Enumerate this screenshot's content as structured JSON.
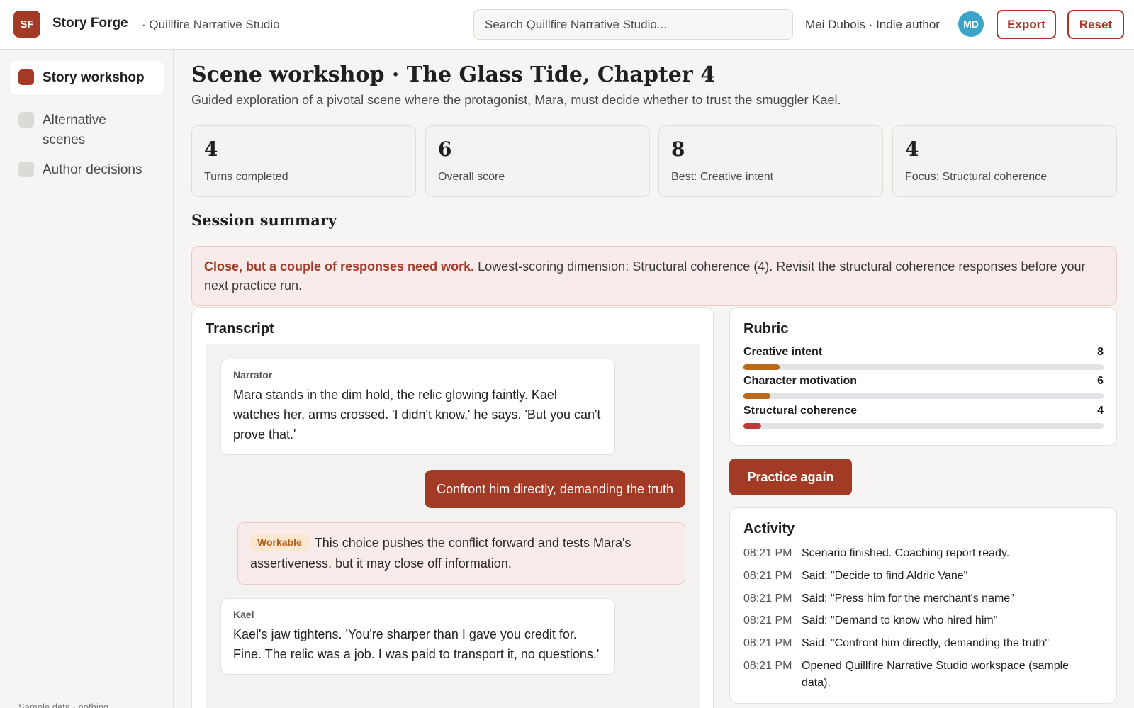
{
  "app": {
    "logo_initials": "SF",
    "name": "Story Forge",
    "org": "· Quillfire Narrative Studio"
  },
  "search": {
    "placeholder": "Search Quillfire Narrative Studio..."
  },
  "user": {
    "label": "Mei Dubois · Indie author",
    "initials": "MD"
  },
  "actions": {
    "export": "Export",
    "reset": "Reset"
  },
  "sidebar": {
    "items": [
      {
        "label": "Story workshop",
        "active": true
      },
      {
        "label": "Alternative scenes",
        "active": false
      },
      {
        "label": "Author decisions",
        "active": false
      }
    ],
    "footer": "Sample data · nothing"
  },
  "page": {
    "title": "Scene workshop · The Glass Tide, Chapter 4",
    "subtitle": "Guided exploration of a pivotal scene where the protagonist, Mara, must decide whether to trust the smuggler Kael."
  },
  "stats": [
    {
      "value": "4",
      "label": "Turns completed"
    },
    {
      "value": "6",
      "label": "Overall score"
    },
    {
      "value": "8",
      "label": "Best: Creative intent"
    },
    {
      "value": "4",
      "label": "Focus: Structural coherence"
    }
  ],
  "summary": {
    "title": "Session summary",
    "alert_strong": "Close, but a couple of responses need work.",
    "alert_text": " Lowest-scoring dimension: Structural coherence (4). Revisit the structural coherence responses before your next practice run."
  },
  "transcript": {
    "title": "Transcript",
    "messages": [
      {
        "speaker": "Narrator",
        "text": "Mara stands in the dim hold, the relic glowing faintly. Kael watches her, arms crossed. 'I didn't know,' he says. 'But you can't prove that.'"
      },
      {
        "user_choice": "Confront him directly, demanding the truth"
      },
      {
        "badge": "Workable",
        "feedback": "This choice pushes the conflict forward and tests Mara's assertiveness, but it may close off information."
      },
      {
        "speaker": "Kael",
        "text": "Kael's jaw tightens. 'You're sharper than I gave you credit for. Fine. The relic was a job. I was paid to transport it, no questions.'"
      }
    ]
  },
  "rubric": {
    "title": "Rubric",
    "max": 80,
    "items": [
      {
        "name": "Creative intent",
        "value": 8,
        "color": "#b8691c"
      },
      {
        "name": "Character motivation",
        "value": 6,
        "color": "#b8691c"
      },
      {
        "name": "Structural coherence",
        "value": 4,
        "color": "#c0393a"
      }
    ]
  },
  "practice_again": "Practice again",
  "activity": {
    "title": "Activity",
    "items": [
      {
        "time": "08:21 PM",
        "text": "Scenario finished. Coaching report ready."
      },
      {
        "time": "08:21 PM",
        "text": "Said: \"Decide to find Aldric Vane\""
      },
      {
        "time": "08:21 PM",
        "text": "Said: \"Press him for the merchant's name\""
      },
      {
        "time": "08:21 PM",
        "text": "Said: \"Demand to know who hired him\""
      },
      {
        "time": "08:21 PM",
        "text": "Said: \"Confront him directly, demanding the truth\""
      },
      {
        "time": "08:21 PM",
        "text": "Opened Quillfire Narrative Studio workspace (sample data)."
      }
    ]
  },
  "colors": {
    "brand": "#a33a26",
    "avatar": "#3ba5c8",
    "bar_track": "#e3e2e6",
    "alert_bg": "#f8eceb"
  }
}
